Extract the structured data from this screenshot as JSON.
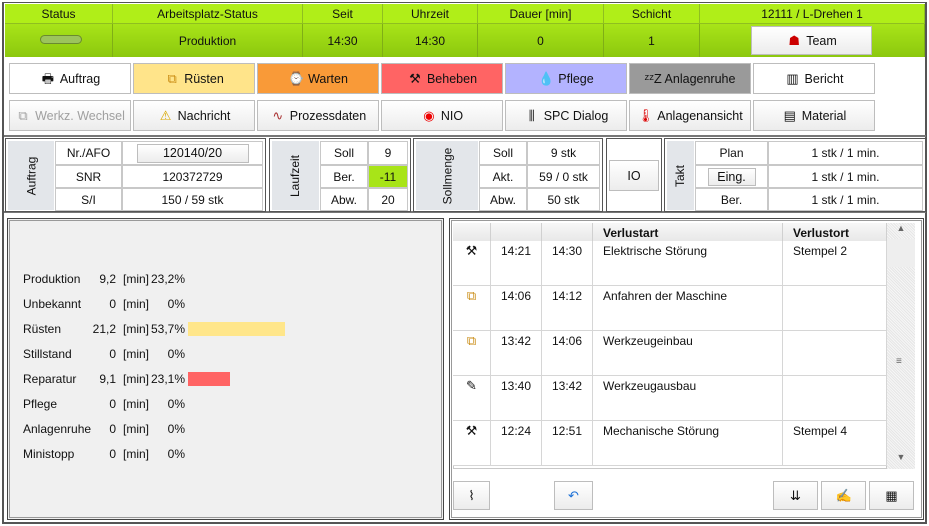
{
  "header": {
    "columns": [
      "Status",
      "Arbeitsplatz-Status",
      "Seit",
      "Uhrzeit",
      "Dauer [min]",
      "Schicht",
      "12111  / L-Drehen 1"
    ],
    "values": {
      "arbeitsplatz_status": "Produktion",
      "seit": "14:30",
      "uhrzeit": "14:30",
      "dauer": "0",
      "schicht": "1"
    },
    "team_button": "Team",
    "status_color": "#9cc45c"
  },
  "buttons_row1": [
    {
      "label": "Auftrag",
      "icon": "order-icon",
      "bg": "#ffffff"
    },
    {
      "label": "Rüsten",
      "icon": "setup-icon",
      "bg": "#ffe48a"
    },
    {
      "label": "Warten",
      "icon": "wait-icon",
      "bg": "#f99a38"
    },
    {
      "label": "Beheben",
      "icon": "tools-icon",
      "bg": "#ff6464"
    },
    {
      "label": "Pflege",
      "icon": "oil-drop-icon",
      "bg": "#b3b3ff"
    },
    {
      "label": "Anlagenruhe",
      "icon": "sleep-icon",
      "bg": "#9a9a9a"
    },
    {
      "label": "Bericht",
      "icon": "report-icon",
      "bg": "#ffffff"
    }
  ],
  "buttons_row2": [
    {
      "label": "Werkz. Wechsel",
      "icon": "tool-change-icon",
      "disabled": true
    },
    {
      "label": "Nachricht",
      "icon": "warning-icon"
    },
    {
      "label": "Prozessdaten",
      "icon": "chart-icon"
    },
    {
      "label": "NIO",
      "icon": "record-icon"
    },
    {
      "label": "SPC Dialog",
      "icon": "spc-icon"
    },
    {
      "label": "Anlagenansicht",
      "icon": "thermometer-icon"
    },
    {
      "label": "Material",
      "icon": "material-icon"
    }
  ],
  "auftrag": {
    "title": "Auftrag",
    "rows": [
      [
        "Nr./AFO",
        "120140/20"
      ],
      [
        "SNR",
        "120372729"
      ],
      [
        "S/I",
        "150  / 59 stk"
      ]
    ]
  },
  "laufzeit": {
    "title": "Laufzeit",
    "rows": [
      [
        "Soll",
        "9"
      ],
      [
        "Ber.",
        "-11"
      ],
      [
        "Abw.",
        "20"
      ]
    ],
    "highlight": "#a8e418"
  },
  "sollmenge": {
    "title": "Sollmenge",
    "rows": [
      [
        "Soll",
        "9 stk"
      ],
      [
        "Akt.",
        "59  / 0 stk"
      ],
      [
        "Abw.",
        "50 stk"
      ]
    ]
  },
  "io_button": "IO",
  "takt": {
    "title": "Takt",
    "rows": [
      [
        "Plan",
        "1 stk  / 1 min."
      ],
      [
        "Eing.",
        "1 stk  / 1 min."
      ],
      [
        "Ber.",
        "1 stk  / 1 min."
      ]
    ]
  },
  "stats": [
    {
      "label": "Produktion",
      "value": "9,2",
      "unit": "[min]",
      "percent": "23,2%",
      "bar": 0,
      "color": null
    },
    {
      "label": "Unbekannt",
      "value": "0",
      "unit": "[min]",
      "percent": "0%",
      "bar": 0,
      "color": null
    },
    {
      "label": "Rüsten",
      "value": "21,2",
      "unit": "[min]",
      "percent": "53,7%",
      "bar": 53.7,
      "color": "#ffe68a"
    },
    {
      "label": "Stillstand",
      "value": "0",
      "unit": "[min]",
      "percent": "0%",
      "bar": 0,
      "color": null
    },
    {
      "label": "Reparatur",
      "value": "9,1",
      "unit": "[min]",
      "percent": "23,1%",
      "bar": 23.1,
      "color": "#ff6464"
    },
    {
      "label": "Pflege",
      "value": "0",
      "unit": "[min]",
      "percent": "0%",
      "bar": 0,
      "color": null
    },
    {
      "label": "Anlagenruhe",
      "value": "0",
      "unit": "[min]",
      "percent": "0%",
      "bar": 0,
      "color": null
    },
    {
      "label": "Ministopp",
      "value": "0",
      "unit": "[min]",
      "percent": "0%",
      "bar": 0,
      "color": null
    }
  ],
  "loss_table": {
    "columns": [
      "",
      "",
      "",
      "Verlustart",
      "Verlustort"
    ],
    "rows": [
      {
        "icon": "tools-icon",
        "from": "14:21",
        "to": "14:30",
        "type": "Elektrische Störung",
        "place": "Stempel 2"
      },
      {
        "icon": "setup-icon",
        "from": "14:06",
        "to": "14:12",
        "type": "Anfahren der Maschine",
        "place": ""
      },
      {
        "icon": "setup-icon",
        "from": "13:42",
        "to": "14:06",
        "type": "Werkzeugeinbau",
        "place": ""
      },
      {
        "icon": "tool-icon",
        "from": "13:40",
        "to": "13:42",
        "type": "Werkzeugausbau",
        "place": ""
      },
      {
        "icon": "tools-icon",
        "from": "12:24",
        "to": "12:51",
        "type": "Mechanische Störung",
        "place": "Stempel 4"
      }
    ]
  },
  "bottom_buttons": [
    "broom-icon",
    "undo-icon",
    "sort-icon",
    "edit-note-icon",
    "table-edit-icon"
  ]
}
